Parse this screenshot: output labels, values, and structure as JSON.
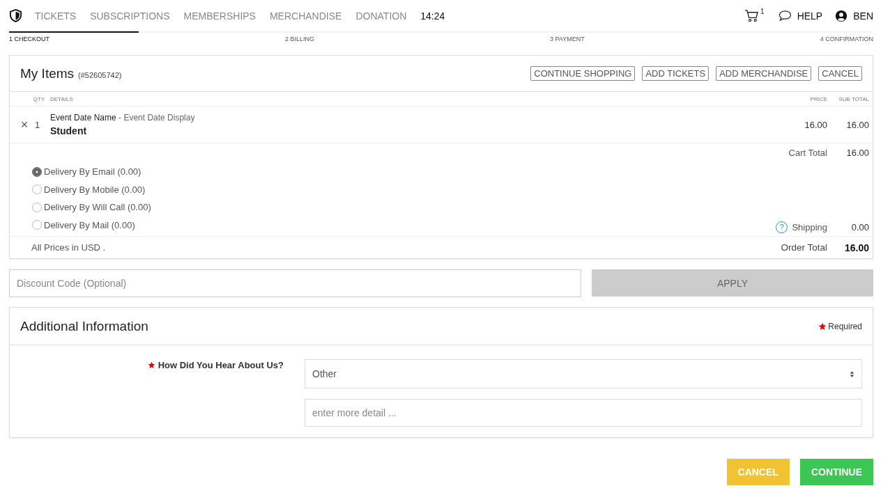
{
  "nav": {
    "links": [
      {
        "label": "TICKETS"
      },
      {
        "label": "SUBSCRIPTIONS"
      },
      {
        "label": "MEMBERSHIPS"
      },
      {
        "label": "MERCHANDISE"
      },
      {
        "label": "DONATION"
      }
    ],
    "timer": "14:24",
    "cart_count": "1",
    "help": "HELP",
    "user": "BEN"
  },
  "steps": [
    {
      "number": "1",
      "label": "CHECKOUT",
      "selected": true
    },
    {
      "number": "2",
      "label": "BILLING",
      "selected": false
    },
    {
      "number": "3",
      "label": "PAYMENT",
      "selected": false
    },
    {
      "number": "4",
      "label": "CONFIRMATION",
      "selected": false
    }
  ],
  "progress": {
    "level": 0.15
  },
  "cart": {
    "title": "My Items",
    "order_number": "(#52605742)",
    "actions": [
      "CONTINUE SHOPPING",
      "ADD TICKETS",
      "ADD MERCHANDISE",
      "CANCEL"
    ],
    "columns": {
      "qty": "QTY",
      "details": "DETAILS",
      "price": "PRICE",
      "subtotal": "SUB TOTAL"
    },
    "items": [
      {
        "remove": "×",
        "qty": "1",
        "event_name": "Event Date Name",
        "separator": " - ",
        "event_display": "Event Date Display",
        "type": "Student",
        "price": "16.00",
        "subtotal": "16.00"
      }
    ],
    "cart_total_label": "Cart Total",
    "cart_total": "16.00",
    "delivery": [
      {
        "label": "Delivery By Email (0.00)",
        "selected": true
      },
      {
        "label": "Delivery By Mobile (0.00)",
        "selected": false
      },
      {
        "label": "Delivery By Will Call (0.00)",
        "selected": false
      },
      {
        "label": "Delivery By Mail (0.00)",
        "selected": false
      }
    ],
    "shipping_help": "?",
    "shipping_label": "Shipping",
    "shipping": "0.00",
    "currency_note": "All Prices in USD .",
    "order_total_label": "Order Total",
    "order_total": "16.00"
  },
  "discount": {
    "placeholder": "Discount Code (Optional)",
    "button": "APPLY",
    "disabled": true
  },
  "additional": {
    "title": "Additional Information",
    "required": "Required",
    "question": "How Did You Hear About Us?",
    "answer": "Other",
    "detail_placeholder": "enter more detail ..."
  },
  "footer": {
    "cancel": "CANCEL",
    "continue": "CONTINUE"
  }
}
